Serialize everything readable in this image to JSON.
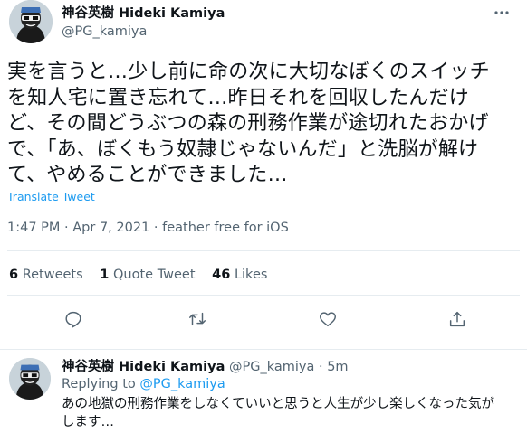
{
  "tweet": {
    "display_name": "神谷英樹 Hideki Kamiya",
    "handle": "@PG_kamiya",
    "text_lines": [
      "実を言うと…少し前に命の次に大切なぼくのスイッチ",
      "を知人宅に置き忘れて…昨日それを回収したんだけ",
      "ど、その間どうぶつの森の刑務作業が途切れたおかげ",
      "で、「あ、ぼくもう奴隷じゃないんだ」と洗脳が解け",
      "て、やめることができました…"
    ],
    "translate_label": "Translate Tweet",
    "meta": "1:47 PM · Apr 7, 2021 · feather free for iOS",
    "stats": {
      "retweets_count": "6",
      "retweets_label": "Retweets",
      "quotes_count": "1",
      "quotes_label": "Quote Tweet",
      "likes_count": "46",
      "likes_label": "Likes"
    },
    "actions": [
      "reply-icon",
      "retweet-icon",
      "like-icon",
      "share-icon"
    ]
  },
  "reply": {
    "display_name": "神谷英樹 Hideki Kamiya",
    "handle": "@PG_kamiya",
    "separator": " · ",
    "time": "5m",
    "replying_to_label": "Replying to",
    "replying_to_handle": "@PG_kamiya",
    "text_lines": [
      "あの地獄の刑務作業をしなくていいと思うと人生が少し楽しくなった気が",
      "します…"
    ]
  },
  "colors": {
    "accent": "#1d9bf0",
    "secondary_text": "#536471",
    "divider": "#e6ecf0"
  }
}
